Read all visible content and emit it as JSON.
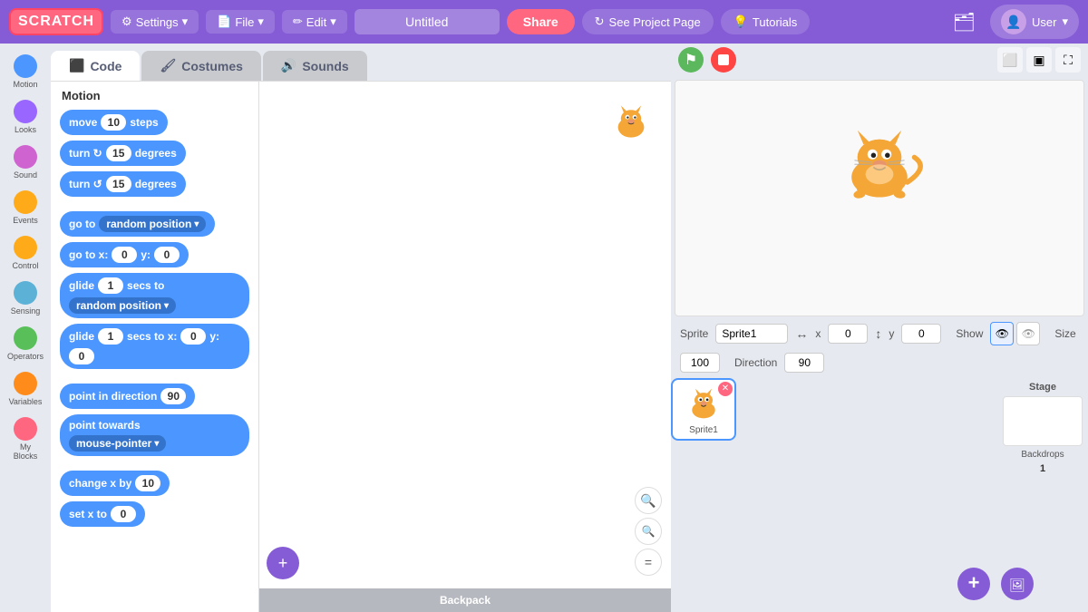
{
  "nav": {
    "logo": "SCRATCH",
    "settings_label": "Settings",
    "file_label": "File",
    "edit_label": "Edit",
    "title_placeholder": "Untitled",
    "share_label": "Share",
    "see_project_label": "See Project Page",
    "tutorials_label": "Tutorials",
    "user_label": "User"
  },
  "tabs": {
    "code_label": "Code",
    "costumes_label": "Costumes",
    "sounds_label": "Sounds"
  },
  "categories": [
    {
      "id": "motion",
      "label": "Motion",
      "color": "#4c97ff"
    },
    {
      "id": "looks",
      "label": "Looks",
      "color": "#9966ff"
    },
    {
      "id": "sound",
      "label": "Sound",
      "color": "#cf63cf"
    },
    {
      "id": "events",
      "label": "Events",
      "color": "#ffab19"
    },
    {
      "id": "control",
      "label": "Control",
      "color": "#ffab19"
    },
    {
      "id": "sensing",
      "label": "Sensing",
      "color": "#5cb1d6"
    },
    {
      "id": "operators",
      "label": "Operators",
      "color": "#59c059"
    },
    {
      "id": "variables",
      "label": "Variables",
      "color": "#ff8c1a"
    },
    {
      "id": "my_blocks",
      "label": "My Blocks",
      "color": "#ff6680"
    }
  ],
  "blocks_title": "Motion",
  "blocks": [
    {
      "id": "move",
      "text": "move",
      "value": "10",
      "suffix": "steps"
    },
    {
      "id": "turn_cw",
      "text": "turn ↻",
      "value": "15",
      "suffix": "degrees"
    },
    {
      "id": "turn_ccw",
      "text": "turn ↺",
      "value": "15",
      "suffix": "degrees"
    },
    {
      "id": "goto",
      "text": "go to",
      "dropdown": "random position"
    },
    {
      "id": "goto_xy",
      "text": "go to x:",
      "x": "0",
      "y_label": "y:",
      "y": "0"
    },
    {
      "id": "glide1",
      "text": "glide",
      "value": "1",
      "mid": "secs to",
      "dropdown": "random position"
    },
    {
      "id": "glide2",
      "text": "glide",
      "value": "1",
      "mid": "secs to x:",
      "x": "0",
      "y_label": "y:",
      "y": "0"
    },
    {
      "id": "point_dir",
      "text": "point in direction",
      "value": "90"
    },
    {
      "id": "point_towards",
      "text": "point towards",
      "dropdown": "mouse-pointer"
    },
    {
      "id": "change_x",
      "text": "change x by",
      "value": "10"
    },
    {
      "id": "set_x",
      "text": "set x to",
      "value": "0"
    }
  ],
  "sprite": {
    "name": "Sprite1",
    "x": "0",
    "y": "0",
    "size": "100",
    "direction": "90"
  },
  "backpack_label": "Backpack",
  "stage": {
    "label": "Stage",
    "backdrops_label": "Backdrops",
    "backdrops_count": "1"
  },
  "zoom": {
    "in": "+",
    "out": "−",
    "reset": "="
  }
}
